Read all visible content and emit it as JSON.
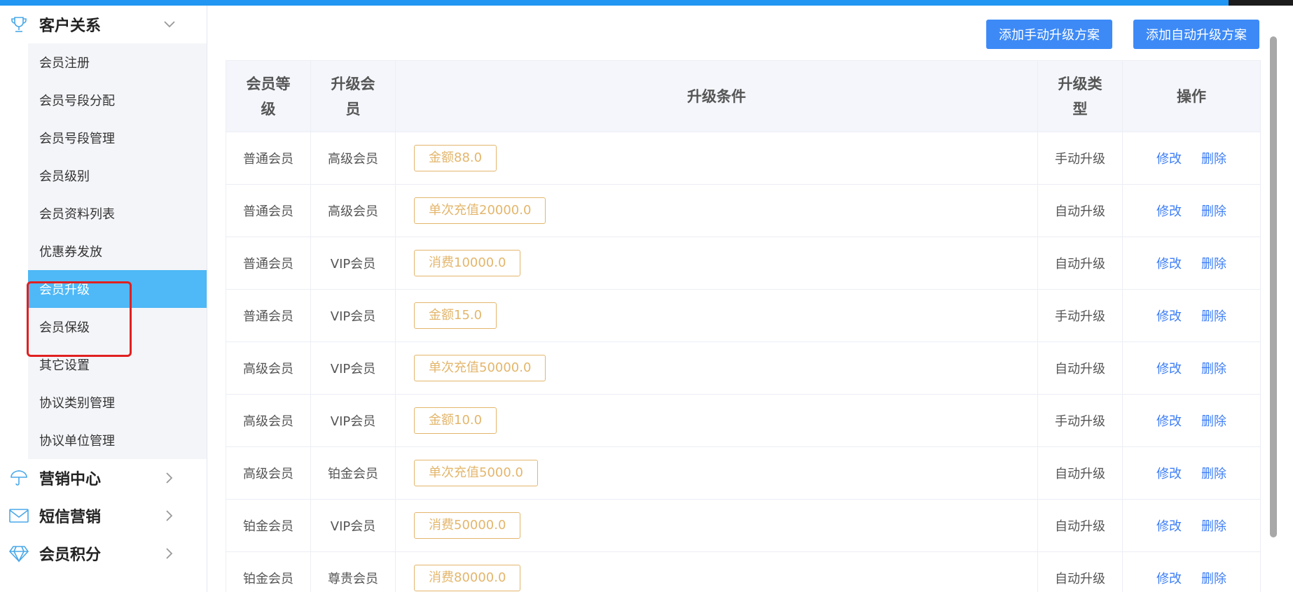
{
  "sidebar": {
    "groups": [
      {
        "title": "客户关系",
        "icon": "trophy-icon",
        "expanded": true,
        "items": [
          "会员注册",
          "会员号段分配",
          "会员号段管理",
          "会员级别",
          "会员资料列表",
          "优惠券发放",
          "会员升级",
          "会员保级",
          "其它设置",
          "协议类别管理",
          "协议单位管理"
        ],
        "active_index": 6
      },
      {
        "title": "营销中心",
        "icon": "umbrella-icon",
        "expanded": false
      },
      {
        "title": "短信营销",
        "icon": "mail-icon",
        "expanded": false
      },
      {
        "title": "会员积分",
        "icon": "diamond-icon",
        "expanded": false
      }
    ]
  },
  "toolbar": {
    "add_manual_label": "添加手动升级方案",
    "add_auto_label": "添加自动升级方案"
  },
  "table": {
    "headers": {
      "level_line1": "会员等",
      "level_line2": "级",
      "upgrade_line1": "升级会",
      "upgrade_line2": "员",
      "condition": "升级条件",
      "type_line1": "升级类",
      "type_line2": "型",
      "action": "操作"
    },
    "edit_label": "修改",
    "delete_label": "删除",
    "rows": [
      {
        "level": "普通会员",
        "upgrade": "高级会员",
        "condition": "金额88.0",
        "type": "手动升级"
      },
      {
        "level": "普通会员",
        "upgrade": "高级会员",
        "condition": "单次充值20000.0",
        "type": "自动升级"
      },
      {
        "level": "普通会员",
        "upgrade": "VIP会员",
        "condition": "消费10000.0",
        "type": "自动升级"
      },
      {
        "level": "普通会员",
        "upgrade": "VIP会员",
        "condition": "金额15.0",
        "type": "手动升级"
      },
      {
        "level": "高级会员",
        "upgrade": "VIP会员",
        "condition": "单次充值50000.0",
        "type": "自动升级"
      },
      {
        "level": "高级会员",
        "upgrade": "VIP会员",
        "condition": "金额10.0",
        "type": "手动升级"
      },
      {
        "level": "高级会员",
        "upgrade": "铂金会员",
        "condition": "单次充值5000.0",
        "type": "自动升级"
      },
      {
        "level": "铂金会员",
        "upgrade": "VIP会员",
        "condition": "消费50000.0",
        "type": "自动升级"
      },
      {
        "level": "铂金会员",
        "upgrade": "尊贵会员",
        "condition": "消费80000.0",
        "type": "自动升级"
      }
    ]
  },
  "colors": {
    "accent": "#3d8af7",
    "active_menu": "#4fb8f6",
    "tag": "#e3b66c",
    "link": "#3d7ef6",
    "highlight": "#e02020"
  }
}
